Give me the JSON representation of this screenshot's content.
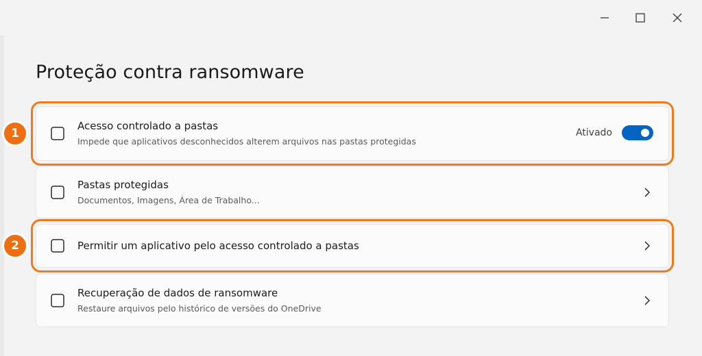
{
  "window": {
    "minimize_icon": "minimize-icon",
    "maximize_icon": "maximize-icon",
    "close_icon": "close-icon"
  },
  "page": {
    "title": "Proteção contra ransomware"
  },
  "cards": [
    {
      "title": "Acesso controlado a pastas",
      "subtitle": "Impede que aplicativos desconhecidos alterem arquivos nas pastas protegidas",
      "toggle_label": "Ativado",
      "toggle_on": true,
      "badge": "1"
    },
    {
      "title": "Pastas protegidas",
      "subtitle": "Documentos, Imagens, Área de Trabalho..."
    },
    {
      "title": "Permitir um aplicativo pelo acesso controlado a pastas",
      "badge": "2"
    },
    {
      "title": "Recuperação de dados de ransomware",
      "subtitle": "Restaure arquivos pelo histórico de versões do OneDrive"
    }
  ],
  "colors": {
    "accent": "#0563c1",
    "highlight": "#f07a1c",
    "badge": "#ee6f12"
  }
}
